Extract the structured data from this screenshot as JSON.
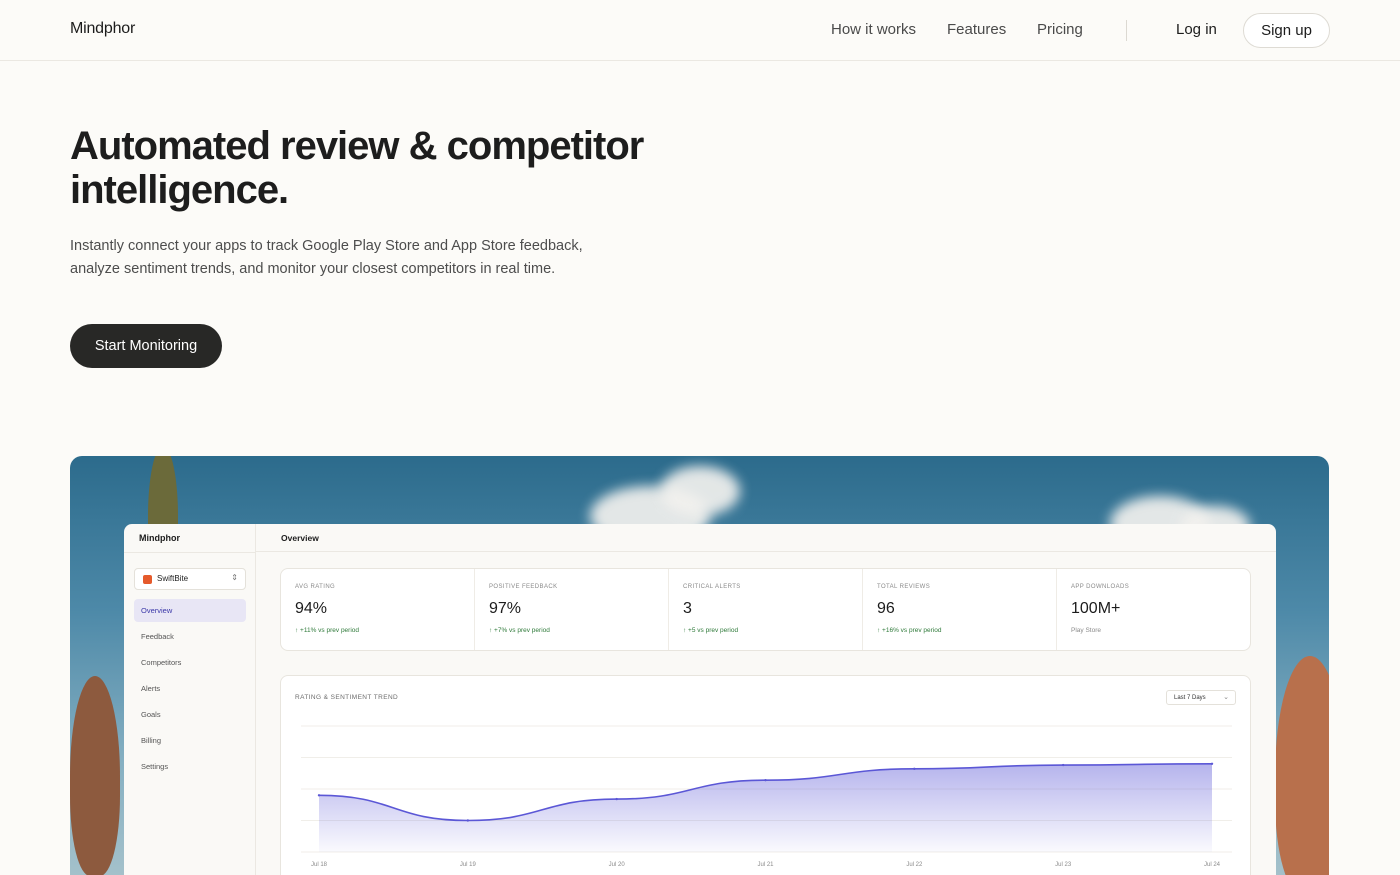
{
  "nav": {
    "brand": "Mindphor",
    "links": [
      "How it works",
      "Features",
      "Pricing"
    ],
    "login": "Log in",
    "signup": "Sign up"
  },
  "hero": {
    "title": "Automated review & competitor intelligence.",
    "subtitle": "Instantly connect your apps to track Google Play Store and App Store feedback, analyze sentiment trends, and monitor your closest competitors in real time.",
    "cta": "Start Monitoring"
  },
  "dashboard": {
    "brand": "Mindphor",
    "app_selector": "SwiftBite",
    "sidebar": [
      "Overview",
      "Feedback",
      "Competitors",
      "Alerts",
      "Goals",
      "Billing",
      "Settings"
    ],
    "active_item": "Overview",
    "page_title": "Overview",
    "kpis": [
      {
        "label": "AVG RATING",
        "value": "94%",
        "delta": "↑ +11% vs prev period"
      },
      {
        "label": "POSITIVE FEEDBACK",
        "value": "97%",
        "delta": "↑ +7% vs prev period"
      },
      {
        "label": "CRITICAL ALERTS",
        "value": "3",
        "delta": "↑ +5 vs prev period"
      },
      {
        "label": "TOTAL REVIEWS",
        "value": "96",
        "delta": "↑ +16% vs prev period"
      },
      {
        "label": "APP DOWNLOADS",
        "value": "100M+",
        "delta": "Play Store"
      }
    ],
    "trend_title": "RATING & SENTIMENT TREND",
    "range": "Last 7 Days"
  },
  "colors": {
    "accent": "#5b57d6",
    "positive": "#2f7a3a",
    "cta_bg": "#282826",
    "page_bg": "#fcfbf8"
  },
  "chart_data": {
    "type": "area",
    "title": "RATING & SENTIMENT TREND",
    "categories": [
      "Jul 18",
      "Jul 19",
      "Jul 20",
      "Jul 21",
      "Jul 22",
      "Jul 23",
      "Jul 24"
    ],
    "series": [
      {
        "values": [
          45,
          25,
          42,
          57,
          66,
          69,
          70
        ]
      }
    ],
    "ylim": [
      0,
      100
    ],
    "grid": true,
    "legend": "none"
  }
}
